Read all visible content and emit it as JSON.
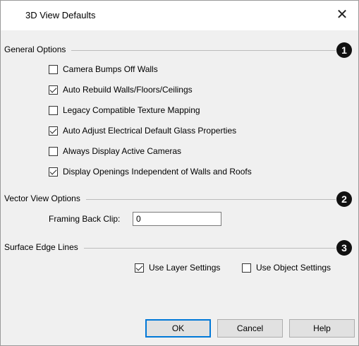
{
  "window": {
    "title": "3D View Defaults",
    "close_glyph": "✕"
  },
  "general": {
    "title": "General Options",
    "badge": "1",
    "options": [
      {
        "label": "Camera Bumps Off Walls",
        "checked": false
      },
      {
        "label": "Auto Rebuild Walls/Floors/Ceilings",
        "checked": true
      },
      {
        "label": "Legacy Compatible Texture Mapping",
        "checked": false
      },
      {
        "label": "Auto Adjust Electrical Default Glass Properties",
        "checked": true
      },
      {
        "label": "Always Display Active Cameras",
        "checked": false
      },
      {
        "label": "Display Openings Independent of Walls and Roofs",
        "checked": true
      }
    ]
  },
  "vector": {
    "title": "Vector View Options",
    "badge": "2",
    "framing_label": "Framing Back Clip:",
    "framing_value": "0"
  },
  "edges": {
    "title": "Surface Edge Lines",
    "badge": "3",
    "use_layer": {
      "label": "Use Layer Settings",
      "checked": true
    },
    "use_object": {
      "label": "Use Object Settings",
      "checked": false
    }
  },
  "buttons": {
    "ok": "OK",
    "cancel": "Cancel",
    "help": "Help"
  },
  "colors": {
    "dialog_bg": "#f0f0f0",
    "focus_blue": "#0078d7",
    "badge": "#111111"
  }
}
